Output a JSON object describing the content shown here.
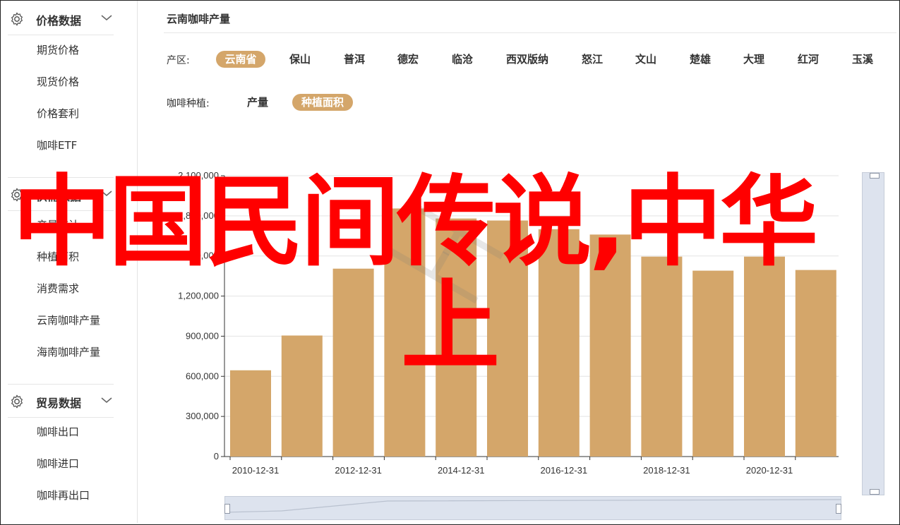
{
  "sidebar": {
    "groups": [
      {
        "title": "价格数据",
        "icon": "gear-icon",
        "items": [
          "期货价格",
          "现货价格",
          "价格套利",
          "咖啡ETF"
        ]
      },
      {
        "title": "供需数据",
        "icon": "gear-icon",
        "items": [
          "产量统计",
          "种植面积",
          "消费需求",
          "云南咖啡产量",
          "海南咖啡产量"
        ]
      },
      {
        "title": "贸易数据",
        "icon": "gear-icon",
        "items": [
          "咖啡出口",
          "咖啡进口",
          "咖啡再出口"
        ]
      }
    ]
  },
  "main": {
    "title": "云南咖啡产量",
    "region_label": "产区:",
    "regions": [
      "云南省",
      "保山",
      "普洱",
      "德宏",
      "临沧",
      "西双版纳",
      "怒江",
      "文山",
      "楚雄",
      "大理",
      "红河",
      "玉溪"
    ],
    "region_selected": "云南省",
    "metric_label": "咖啡种植:",
    "metrics": [
      "产量",
      "种植面积"
    ],
    "metric_selected": "种植面积"
  },
  "chart_data": {
    "type": "bar",
    "x": [
      "2010-12-31",
      "2011-12-31",
      "2012-12-31",
      "2013-12-31",
      "2014-12-31",
      "2015-12-31",
      "2016-12-31",
      "2017-12-31",
      "2018-12-31",
      "2019-12-31",
      "2020-12-31",
      "2021-12-31"
    ],
    "values": [
      645000,
      905000,
      1405000,
      1855000,
      1780000,
      1765000,
      1700000,
      1660000,
      1495000,
      1390000,
      1495000,
      1395000
    ],
    "x_tick_labels": [
      "2010-12-31",
      "2012-12-31",
      "2014-12-31",
      "2016-12-31",
      "2018-12-31",
      "2020-12-31"
    ],
    "y_tick_labels": [
      "0",
      "300,000",
      "600,000",
      "900,000",
      "1,200,000",
      "1,500,000",
      "1,800,000",
      "2,100,000"
    ],
    "ylim": [
      0,
      2100000
    ],
    "bar_color": "#d4a66a",
    "grid": true
  },
  "overlay": {
    "line1": "中国民间传说,中华",
    "line2": "上",
    "color": "#ff0000"
  },
  "colors": {
    "accent": "#d4a66a",
    "scrollbar": "#dde3ee"
  }
}
